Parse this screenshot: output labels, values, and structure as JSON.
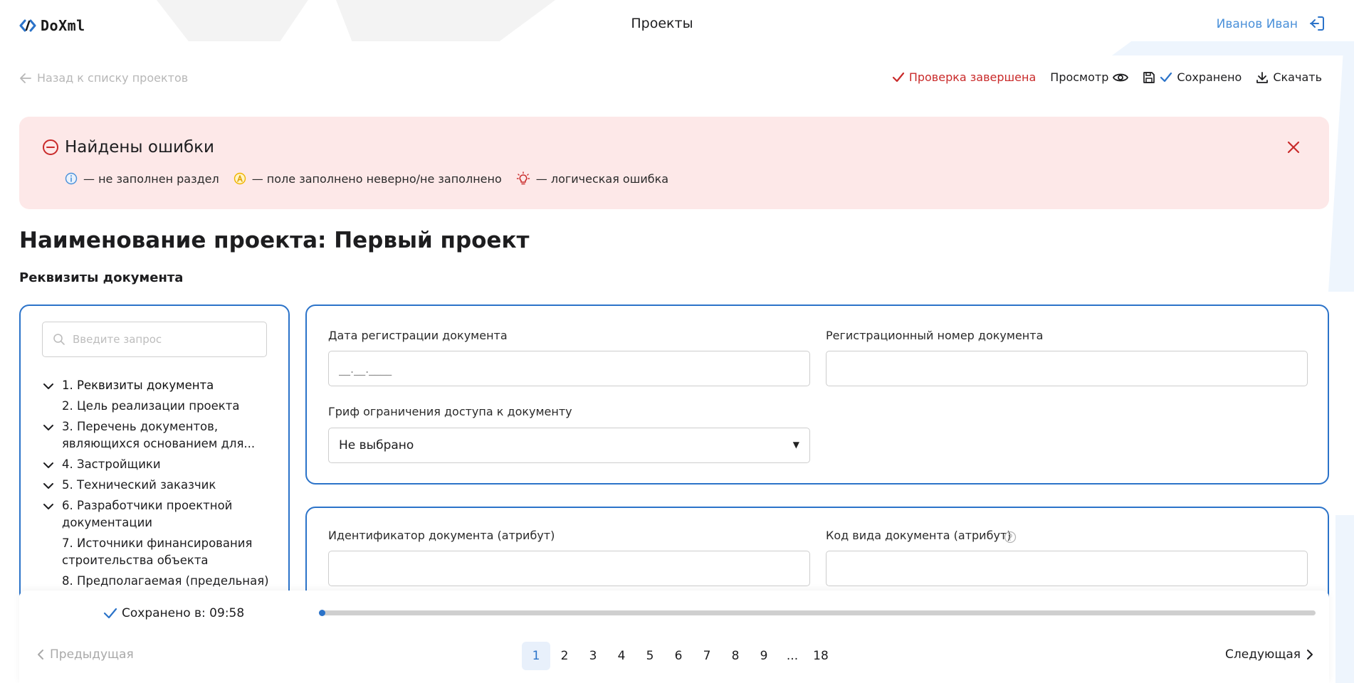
{
  "header": {
    "logo_text": "DoXml",
    "title": "Проекты",
    "user_name": "Иванов Иван"
  },
  "toolbar": {
    "back_label": "Назад к списку проектов",
    "check_status": "Проверка завершена",
    "preview_label": "Просмотр",
    "saved_label": "Сохранено",
    "download_label": "Скачать"
  },
  "banner": {
    "title": "Найдены ошибки",
    "legend": [
      {
        "icon": "info-icon",
        "text": "— не заполнен раздел"
      },
      {
        "icon": "warning-a-icon",
        "text": "— поле заполнено неверно/не заполнено"
      },
      {
        "icon": "bulb-icon",
        "text": "— логическая ошибка"
      }
    ]
  },
  "project_title": "Наименование проекта: Первый проект",
  "section_title": "Реквизиты документа",
  "sidebar": {
    "search_placeholder": "Введите запрос",
    "items": [
      {
        "label": "1. Реквизиты документа",
        "expandable": true
      },
      {
        "label": "2. Цель реализации проекта",
        "expandable": false
      },
      {
        "label": "3. Перечень документов, являющихся основанием для...",
        "expandable": true
      },
      {
        "label": "4. Застройщики",
        "expandable": true
      },
      {
        "label": "5. Технический заказчик",
        "expandable": true
      },
      {
        "label": "6. Разработчики проектной документации",
        "expandable": true
      },
      {
        "label": "7. Источники финансирования строительства объекта",
        "expandable": false
      },
      {
        "label": "8. Предполагаемая (предельная)",
        "expandable": false
      }
    ]
  },
  "form": {
    "reg_date_label": "Дата регистрации документа",
    "reg_date_placeholder": "__.__.____",
    "reg_number_label": "Регистрационный номер документа",
    "access_label": "Гриф ограничения доступа к документу",
    "access_value": "Не выбрано",
    "doc_id_label": "Идентификатор документа (атрибут)",
    "doc_type_label": "Код вида документа (атрибут)"
  },
  "footer": {
    "saved_at": "Сохранено в: 09:58",
    "prev_label": "Предыдущая",
    "next_label": "Следующая",
    "pages": [
      "1",
      "2",
      "3",
      "4",
      "5",
      "6",
      "7",
      "8",
      "9",
      "...",
      "18"
    ],
    "current_page": "1"
  },
  "colors": {
    "accent": "#2b73c9",
    "error": "#c92a2a",
    "banner_bg": "#fde8e8",
    "user_link": "#4a90d9"
  }
}
